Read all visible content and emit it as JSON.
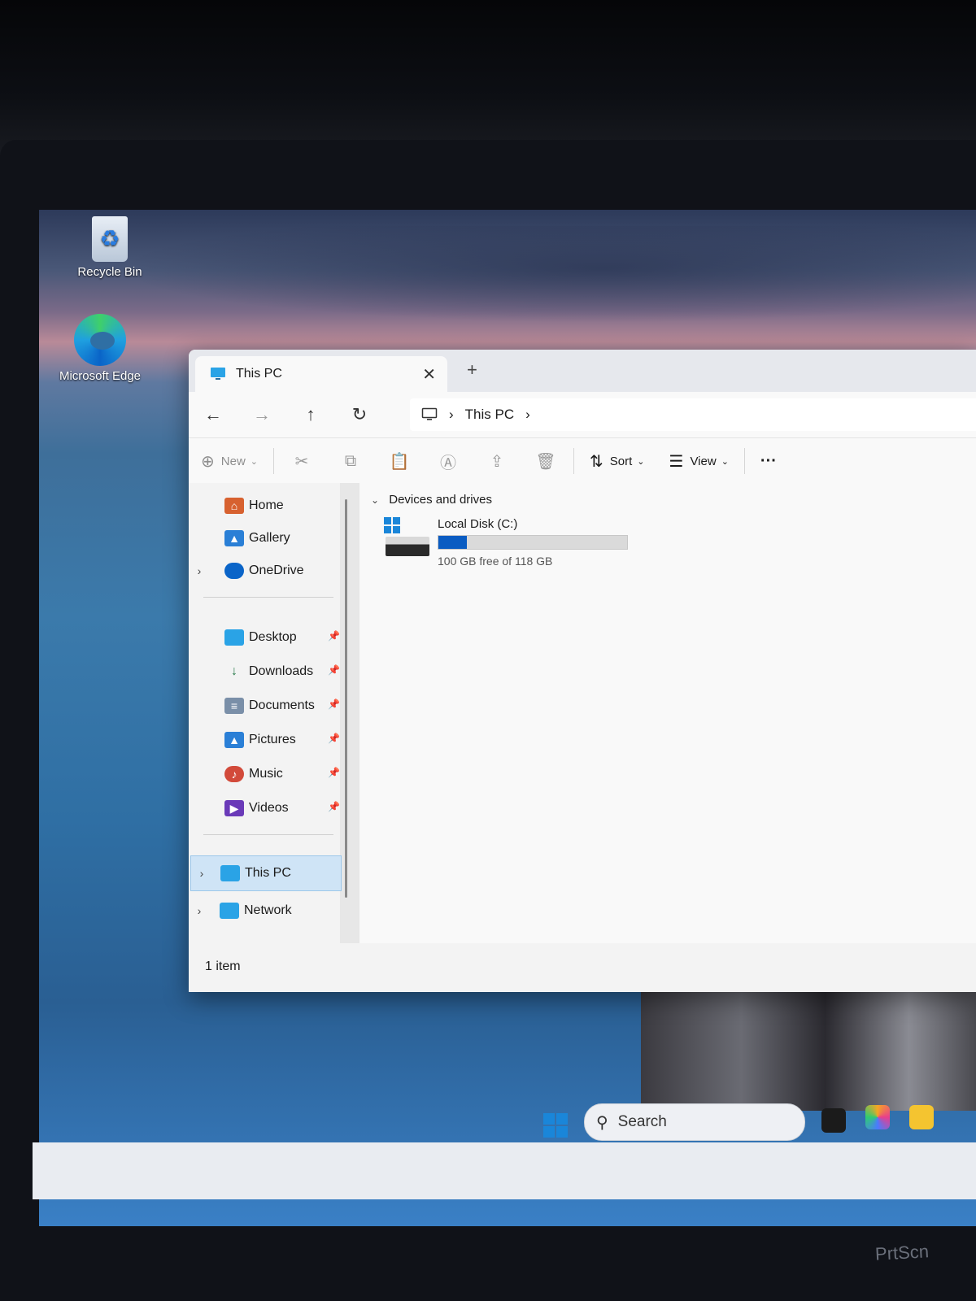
{
  "desktop": {
    "icons": [
      {
        "label": "Recycle Bin",
        "icon": "recycle-bin-icon"
      },
      {
        "label": "Microsoft Edge",
        "icon": "edge-icon"
      }
    ]
  },
  "window": {
    "tab_title": "This PC",
    "tab_close": "✕",
    "new_tab": "+",
    "nav": {
      "back": "←",
      "forward": "→",
      "up": "↑",
      "refresh": "↻"
    },
    "address": {
      "root_icon": "monitor-icon",
      "sep": "›",
      "crumb": "This PC",
      "sep2": "›"
    },
    "commands": {
      "new_label": "New",
      "sort_label": "Sort",
      "view_label": "View",
      "more_label": "···"
    },
    "sidebar": {
      "items": [
        {
          "label": "Home",
          "icon": "home-icon"
        },
        {
          "label": "Gallery",
          "icon": "gallery-icon"
        },
        {
          "label": "OneDrive",
          "icon": "onedrive-icon"
        },
        {
          "label": "Desktop",
          "icon": "desktop-folder-icon"
        },
        {
          "label": "Downloads",
          "icon": "downloads-icon"
        },
        {
          "label": "Documents",
          "icon": "documents-icon"
        },
        {
          "label": "Pictures",
          "icon": "pictures-icon"
        },
        {
          "label": "Music",
          "icon": "music-icon"
        },
        {
          "label": "Videos",
          "icon": "videos-icon"
        },
        {
          "label": "This PC",
          "icon": "this-pc-icon",
          "selected": true
        },
        {
          "label": "Network",
          "icon": "network-icon"
        }
      ]
    },
    "content": {
      "group": "Devices and drives",
      "drives": [
        {
          "name": "Local Disk (C:)",
          "free_text": "100 GB free of 118 GB",
          "used_fraction": 0.15
        }
      ]
    },
    "status": "1 item"
  },
  "taskbar": {
    "search_placeholder": "Search"
  },
  "keyboard": {
    "key": "PrtScn"
  },
  "colors": {
    "accent": "#0a5cc2",
    "selection": "#cfe4f6"
  }
}
